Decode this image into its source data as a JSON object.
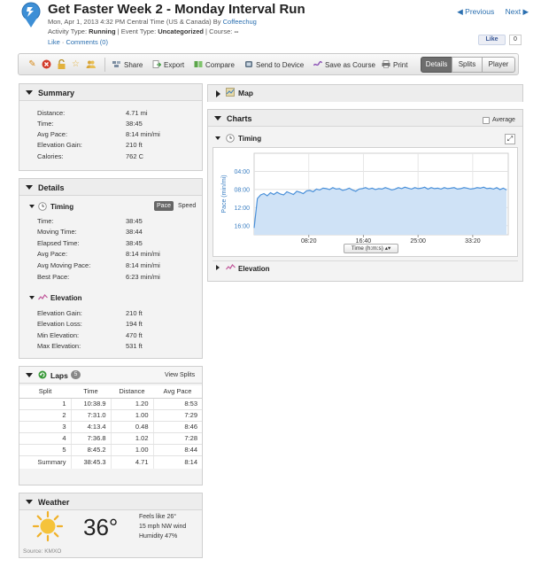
{
  "header": {
    "title": "Get Faster Week 2 - Monday Interval Run",
    "date_line": "Mon, Apr 1, 2013 4:32 PM Central Time (US & Canada) By",
    "author": "Coffeechug",
    "activity_type_label": "Activity Type:",
    "activity_type": "Running",
    "event_type_label": "| Event Type:",
    "event_type": "Uncategorized",
    "course_label": "| Course:",
    "course": "--",
    "like_link": "Like",
    "comments_link": "Comments (0)",
    "fb_like": "Like",
    "fb_count": "0",
    "nav_previous": "◀ Previous",
    "nav_next": "Next ▶"
  },
  "toolbar": {
    "share": "Share",
    "export": "Export",
    "compare": "Compare",
    "send_to_device": "Send to Device",
    "save_as_course": "Save as Course",
    "print": "Print",
    "tabs": [
      "Details",
      "Splits",
      "Player"
    ],
    "active_tab": "Details",
    "icons": [
      "pencil-icon",
      "delete-icon",
      "lock-icon",
      "star-icon",
      "users-icon"
    ]
  },
  "summary": {
    "title": "Summary",
    "rows": [
      {
        "label": "Distance:",
        "value": "4.71 mi"
      },
      {
        "label": "Time:",
        "value": "38:45"
      },
      {
        "label": "Avg Pace:",
        "value": "8:14 min/mi"
      },
      {
        "label": "Elevation Gain:",
        "value": "210 ft"
      },
      {
        "label": "Calories:",
        "value": "762 C"
      }
    ]
  },
  "details": {
    "title": "Details",
    "timing": {
      "title": "Timing",
      "toggle_active": "Pace",
      "toggle_other": "Speed",
      "rows": [
        {
          "label": "Time:",
          "value": "38:45"
        },
        {
          "label": "Moving Time:",
          "value": "38:44"
        },
        {
          "label": "Elapsed Time:",
          "value": "38:45"
        },
        {
          "label": "Avg Pace:",
          "value": "8:14 min/mi"
        },
        {
          "label": "Avg Moving Pace:",
          "value": "8:14 min/mi"
        },
        {
          "label": "Best Pace:",
          "value": "6:23 min/mi"
        }
      ]
    },
    "elevation": {
      "title": "Elevation",
      "rows": [
        {
          "label": "Elevation Gain:",
          "value": "210 ft"
        },
        {
          "label": "Elevation Loss:",
          "value": "194 ft"
        },
        {
          "label": "Min Elevation:",
          "value": "470 ft"
        },
        {
          "label": "Max Elevation:",
          "value": "531 ft"
        }
      ]
    }
  },
  "laps": {
    "title": "Laps",
    "count": "5",
    "view_splits": "View Splits",
    "columns": [
      "Split",
      "Time",
      "Distance",
      "Avg Pace"
    ],
    "rows": [
      [
        "1",
        "10:38.9",
        "1.20",
        "8:53"
      ],
      [
        "2",
        "7:31.0",
        "1.00",
        "7:29"
      ],
      [
        "3",
        "4:13.4",
        "0.48",
        "8:46"
      ],
      [
        "4",
        "7:36.8",
        "1.02",
        "7:28"
      ],
      [
        "5",
        "8:45.2",
        "1.00",
        "8:44"
      ]
    ],
    "summary": [
      "Summary",
      "38:45.3",
      "4.71",
      "8:14"
    ]
  },
  "weather": {
    "title": "Weather",
    "temperature": "36°",
    "feels_like": "Feels like 26°",
    "wind": "15 mph NW wind",
    "humidity": "Humidity 47%",
    "source": "Source: KMXO"
  },
  "map": {
    "title": "Map"
  },
  "charts": {
    "title": "Charts",
    "average_label": "Average",
    "timing_title": "Timing",
    "x_selector": "Time (h:m:s)",
    "elevation_title": "Elevation"
  },
  "chart_data": {
    "type": "area",
    "title": "",
    "xlabel": "",
    "ylabel": "Pace (min/mi)",
    "ylim": [
      0,
      18
    ],
    "y_inverted": true,
    "yticks": [
      "04:00",
      "08:00",
      "12:00",
      "16:00"
    ],
    "xticks": [
      "08:20",
      "16:40",
      "25:00",
      "33:20"
    ],
    "xlim": [
      0,
      38.75
    ],
    "grid": true,
    "color": "#4a90d9",
    "x": [
      0.0,
      0.5,
      1.0,
      1.5,
      2.0,
      2.5,
      3.0,
      3.5,
      4.0,
      4.5,
      5.0,
      5.5,
      6.0,
      6.5,
      7.0,
      7.5,
      8.0,
      8.5,
      9.0,
      9.5,
      10.0,
      10.5,
      11.0,
      11.5,
      12.0,
      12.5,
      13.0,
      13.5,
      14.0,
      14.5,
      15.0,
      15.5,
      16.0,
      16.5,
      17.0,
      17.5,
      18.0,
      18.5,
      19.0,
      19.5,
      20.0,
      20.5,
      21.0,
      21.5,
      22.0,
      22.5,
      23.0,
      23.5,
      24.0,
      24.5,
      25.0,
      25.5,
      26.0,
      26.5,
      27.0,
      27.5,
      28.0,
      28.5,
      29.0,
      29.5,
      30.0,
      30.5,
      31.0,
      31.5,
      32.0,
      32.5,
      33.0,
      33.5,
      34.0,
      34.5,
      35.0,
      35.5,
      36.0,
      36.5,
      37.0,
      37.5,
      38.0,
      38.5
    ],
    "values": [
      16.5,
      10.0,
      9.2,
      8.9,
      9.4,
      8.7,
      9.1,
      8.6,
      9.0,
      9.2,
      8.5,
      8.8,
      9.1,
      8.4,
      8.6,
      8.9,
      8.3,
      8.2,
      8.5,
      7.9,
      8.1,
      7.7,
      7.8,
      8.0,
      7.6,
      7.9,
      7.8,
      8.2,
      8.0,
      7.7,
      8.1,
      8.4,
      7.9,
      7.8,
      7.6,
      7.9,
      7.7,
      8.0,
      7.8,
      7.9,
      7.6,
      7.8,
      8.1,
      7.9,
      7.6,
      7.8,
      7.5,
      7.7,
      7.9,
      7.6,
      7.8,
      7.7,
      7.5,
      7.9,
      7.6,
      7.8,
      7.7,
      7.9,
      7.6,
      7.8,
      7.7,
      7.6,
      7.9,
      7.8,
      7.6,
      7.7,
      7.9,
      7.8,
      7.6,
      7.7,
      7.5,
      7.8,
      7.7,
      7.9,
      7.6,
      8.0,
      7.7,
      8.1
    ]
  }
}
